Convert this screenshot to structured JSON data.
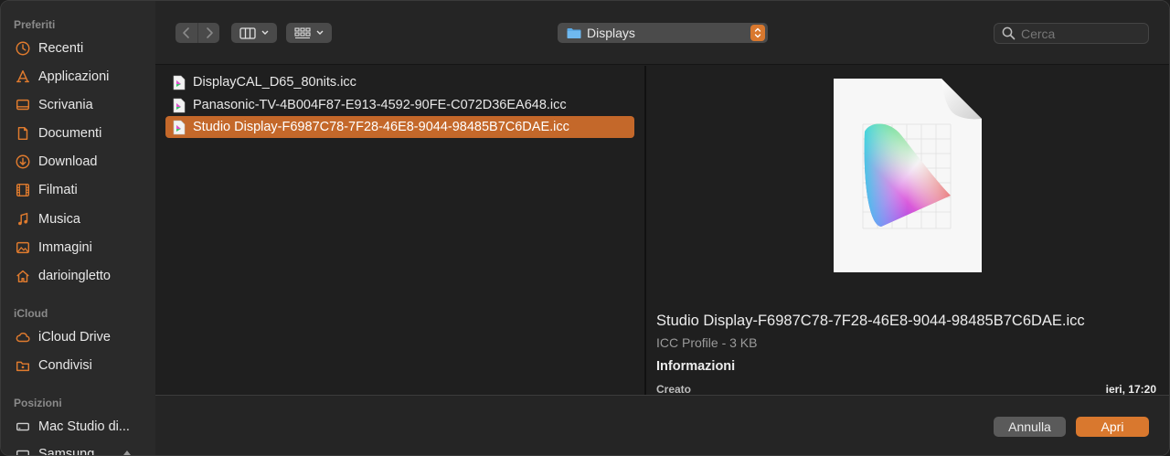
{
  "sidebar": {
    "sections": [
      {
        "label": "Preferiti"
      },
      {
        "label": "iCloud"
      },
      {
        "label": "Posizioni"
      }
    ],
    "favorites": [
      {
        "label": "Recenti",
        "icon": "clock-icon"
      },
      {
        "label": "Applicazioni",
        "icon": "apps-icon"
      },
      {
        "label": "Scrivania",
        "icon": "desktop-icon"
      },
      {
        "label": "Documenti",
        "icon": "document-icon"
      },
      {
        "label": "Download",
        "icon": "download-icon"
      },
      {
        "label": "Filmati",
        "icon": "film-icon"
      },
      {
        "label": "Musica",
        "icon": "music-icon"
      },
      {
        "label": "Immagini",
        "icon": "photo-icon"
      },
      {
        "label": "darioingletto",
        "icon": "home-icon"
      }
    ],
    "icloud": [
      {
        "label": "iCloud Drive",
        "icon": "cloud-icon"
      },
      {
        "label": "Condivisi",
        "icon": "shared-folder-icon"
      }
    ],
    "locations": [
      {
        "label": "Mac Studio di...",
        "icon": "computer-icon"
      },
      {
        "label": "Samsung",
        "icon": "drive-icon"
      }
    ]
  },
  "toolbar": {
    "current_folder": "Displays",
    "search_placeholder": "Cerca"
  },
  "files": [
    {
      "name": "DisplayCAL_D65_80nits.icc",
      "selected": false
    },
    {
      "name": "Panasonic-TV-4B004F87-E913-4592-90FE-C072D36EA648.icc",
      "selected": false
    },
    {
      "name": "Studio Display-F6987C78-7F28-46E8-9044-98485B7C6DAE.icc",
      "selected": true
    }
  ],
  "preview": {
    "name": "Studio Display-F6987C78-7F28-46E8-9044-98485B7C6DAE.icc",
    "kind": "ICC Profile - 3 KB",
    "info_heading": "Informazioni",
    "created_label": "Creato",
    "created_value": "ieri, 17:20"
  },
  "buttons": {
    "cancel": "Annulla",
    "open": "Apri"
  },
  "colors": {
    "accent": "#d9782e",
    "selection": "#c4682a"
  }
}
